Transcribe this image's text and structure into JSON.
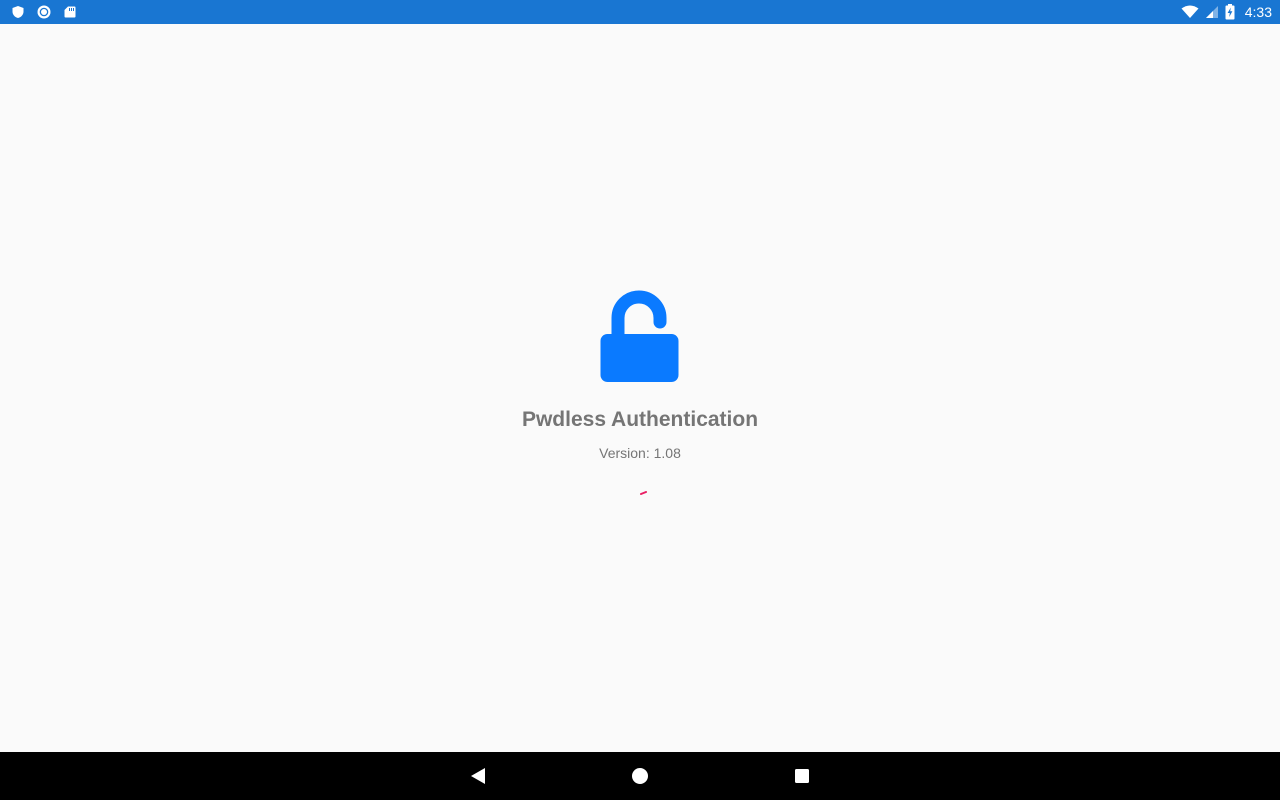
{
  "status_bar": {
    "time": "4:33",
    "left_icons": [
      "shield-icon",
      "sync-icon",
      "sd-card-icon"
    ],
    "right_icons": [
      "wifi-icon",
      "signal-icon",
      "battery-charging-icon"
    ],
    "background_color": "#1976d2"
  },
  "app": {
    "icon": "lock-open-icon",
    "icon_color": "#0a7aff",
    "title": "Pwdless Authentication",
    "version_label": "Version:",
    "version_number": "1.08",
    "text_color": "#757575",
    "spinner_color": "#e91e63"
  },
  "nav_bar": {
    "buttons": [
      "back",
      "home",
      "recents"
    ],
    "background_color": "#000000"
  }
}
